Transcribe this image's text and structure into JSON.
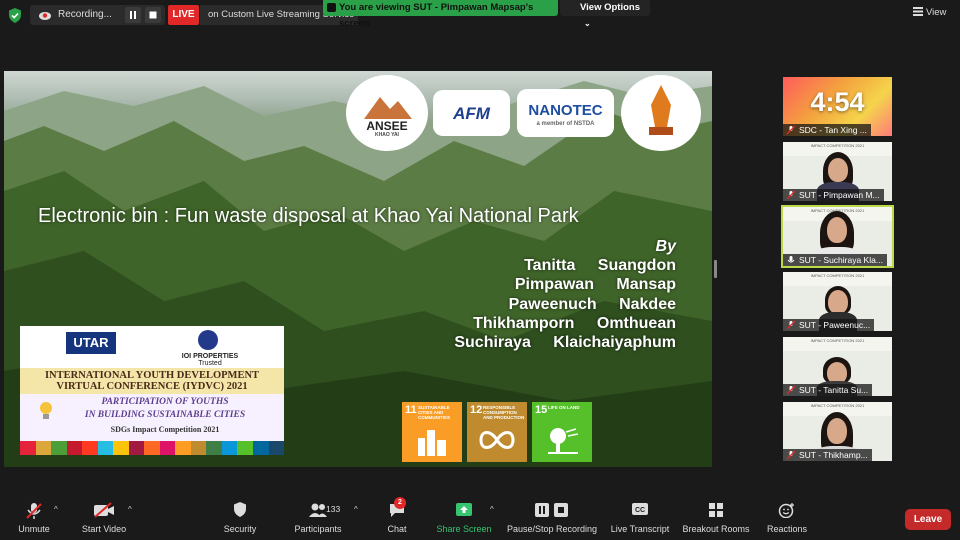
{
  "topbar": {
    "recording_label": "Recording...",
    "live_badge": "LIVE",
    "live_text": "on Custom Live Streaming Service",
    "viewing_banner": "You are viewing SUT - Pimpawan Mapsap's screen",
    "view_options": "View Options",
    "view_button": "View"
  },
  "slide": {
    "title": "Electronic bin :  Fun waste disposal at Khao Yai National Park",
    "by": "By",
    "authors": [
      "Tanitta Suangdon",
      "Pimpawan Mansap",
      "Paweenuch Nakdee",
      "Thikhamporn Omthuean",
      "Suchiraya Klaichaiyaphum"
    ],
    "logos": {
      "ansee": "ANSEE",
      "ansee_sub": "KHAO YAI",
      "afm": "AFM",
      "nanotec": "NANOTEC",
      "nanotec_sub": "a member of NSTDA"
    },
    "poster": {
      "utar": "UTAR",
      "ioi": "IOI PROPERTIES",
      "ioi_sub": "Trusted",
      "conference_line1": "INTERNATIONAL YOUTH DEVELOPMENT",
      "conference_line2": "VIRTUAL CONFERENCE (IYDVC) 2021",
      "participation_line1": "PARTICIPATION OF YOUTHS",
      "participation_line2": "IN BUILDING SUSTAINABLE CITIES",
      "impact": "SDGs Impact Competition 2021"
    },
    "sdgs": [
      {
        "num": "11",
        "caption": "SUSTAINABLE CITIES AND COMMUNITIES"
      },
      {
        "num": "12",
        "caption": "RESPONSIBLE CONSUMPTION AND PRODUCTION"
      },
      {
        "num": "15",
        "caption": "LIFE ON LAND"
      }
    ]
  },
  "gallery": {
    "countdown": "4:54",
    "tiles": [
      {
        "name": "SDC - Tan Xing ..."
      },
      {
        "name": "SUT - Pimpawan M..."
      },
      {
        "name": "SUT - Suchiraya Kla..."
      },
      {
        "name": "SUT - Paweenuc..."
      },
      {
        "name": "SUT - Tanitta Su..."
      },
      {
        "name": "SUT - Thikhamp..."
      }
    ],
    "tile_header": "IMPACT COMPETITION 2021"
  },
  "toolbar": {
    "unmute": "Unmute",
    "start_video": "Start Video",
    "security": "Security",
    "participants": "Participants",
    "participants_count": "133",
    "chat": "Chat",
    "chat_badge": "2",
    "share_screen": "Share Screen",
    "pause_stop": "Pause/Stop Recording",
    "live_transcript": "Live Transcript",
    "breakout": "Breakout Rooms",
    "reactions": "Reactions",
    "leave": "Leave"
  },
  "colors": {
    "share_green": "#36c46f",
    "leave_red": "#c42a2a",
    "active_speaker": "#bcd94a"
  }
}
